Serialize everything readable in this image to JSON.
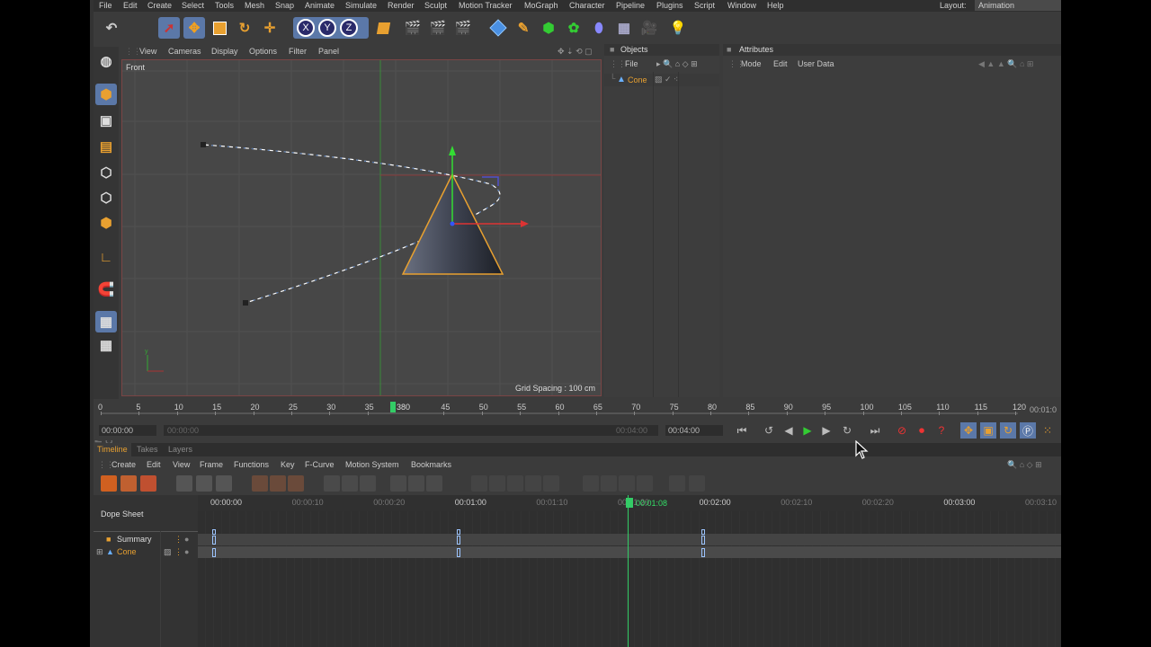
{
  "menu": [
    "File",
    "Edit",
    "Create",
    "Select",
    "Tools",
    "Mesh",
    "Snap",
    "Animate",
    "Simulate",
    "Render",
    "Sculpt",
    "Motion Tracker",
    "MoGraph",
    "Character",
    "Pipeline",
    "Plugins",
    "Script",
    "Window",
    "Help"
  ],
  "layout": {
    "label": "Layout:",
    "value": "Animation"
  },
  "viewport": {
    "menu": [
      "View",
      "Cameras",
      "Display",
      "Options",
      "Filter",
      "Panel"
    ],
    "name": "Front",
    "grid_spacing": "Grid Spacing : 100 cm"
  },
  "objects_panel": {
    "title": "Objects",
    "menu": [
      "File"
    ],
    "items": [
      {
        "name": "Cone"
      }
    ]
  },
  "attributes_panel": {
    "title": "Attributes",
    "menu": [
      "Mode",
      "Edit",
      "User Data"
    ]
  },
  "timeline_ruler": {
    "ticks": [
      "0",
      "5",
      "10",
      "15",
      "20",
      "25",
      "30",
      "35",
      "40",
      "45",
      "50",
      "55",
      "60",
      "65",
      "70",
      "75",
      "80",
      "85",
      "90",
      "95",
      "100",
      "105",
      "110",
      "115",
      "120"
    ],
    "current_frame": "38",
    "current_suffix": "0",
    "end_readout": "00:01:0"
  },
  "playback": {
    "start_time": "00:00:00",
    "range_start": "00:00:00",
    "range_end": "00:04:00",
    "end_time": "00:04:00"
  },
  "tabs": [
    {
      "label": "Timeline",
      "active": true
    },
    {
      "label": "Takes",
      "active": false
    },
    {
      "label": "Layers",
      "active": false
    }
  ],
  "timeline_menu": [
    "Create",
    "Edit",
    "View",
    "Frame",
    "Functions",
    "Key",
    "F-Curve",
    "Motion System",
    "Bookmarks"
  ],
  "dope_sheet": {
    "title": "Dope Sheet",
    "ruler": [
      {
        "label": "00:00:00",
        "dim": false
      },
      {
        "label": "00:00:10",
        "dim": true
      },
      {
        "label": "00:00:20",
        "dim": true
      },
      {
        "label": "00:01:00",
        "dim": false
      },
      {
        "label": "00:01:10",
        "dim": true
      },
      {
        "label": "00:01:20",
        "dim": true
      },
      {
        "label": "00:02:00",
        "dim": false
      },
      {
        "label": "00:02:10",
        "dim": true
      },
      {
        "label": "00:02:20",
        "dim": true
      },
      {
        "label": "00:03:00",
        "dim": false
      },
      {
        "label": "00:03:10",
        "dim": true
      }
    ],
    "current_time": "00:01:08",
    "tracks": [
      {
        "label": "Summary",
        "keys": [
          "00:00:00",
          "00:01:00",
          "00:02:00"
        ]
      },
      {
        "label": "Cone",
        "keys": [
          "00:00:00",
          "00:01:00",
          "00:02:00"
        ]
      }
    ]
  },
  "colors": {
    "accent": "#e8a030",
    "selection": "#5b78a8",
    "playhead": "#33cc66",
    "background": "#3b3b3b"
  }
}
